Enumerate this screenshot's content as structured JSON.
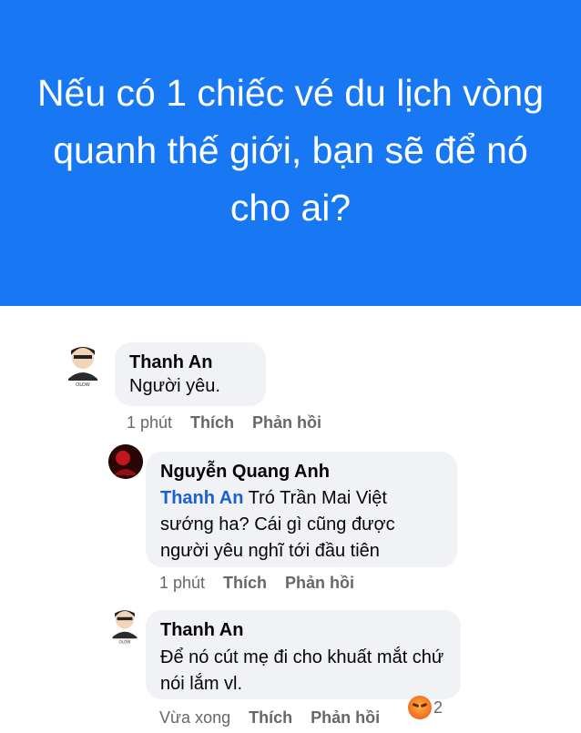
{
  "banner": {
    "title": "Nếu có 1 chiếc vé du lịch vòng quanh thế giới, bạn sẽ để nó cho ai?",
    "color": "#1877f2"
  },
  "comments": [
    {
      "author": "Thanh An",
      "text": "Người yêu.",
      "time": "1 phút",
      "like": "Thích",
      "reply": "Phản hồi"
    },
    {
      "author": "Nguyễn Quang Anh",
      "mention": "Thanh An",
      "text": " Tró Trần Mai Việt sướng ha? Cái gì cũng được người yêu nghĩ tới đầu tiên",
      "time": "1 phút",
      "like": "Thích",
      "reply": "Phản hồi"
    },
    {
      "author": "Thanh An",
      "text": "Để nó cút mẹ đi cho khuất mắt chứ nói lắm vl.",
      "time": "Vừa xong",
      "like": "Thích",
      "reply": "Phản hồi",
      "reaction_icon": "angry-emoji-icon",
      "reaction_count": "2"
    }
  ]
}
